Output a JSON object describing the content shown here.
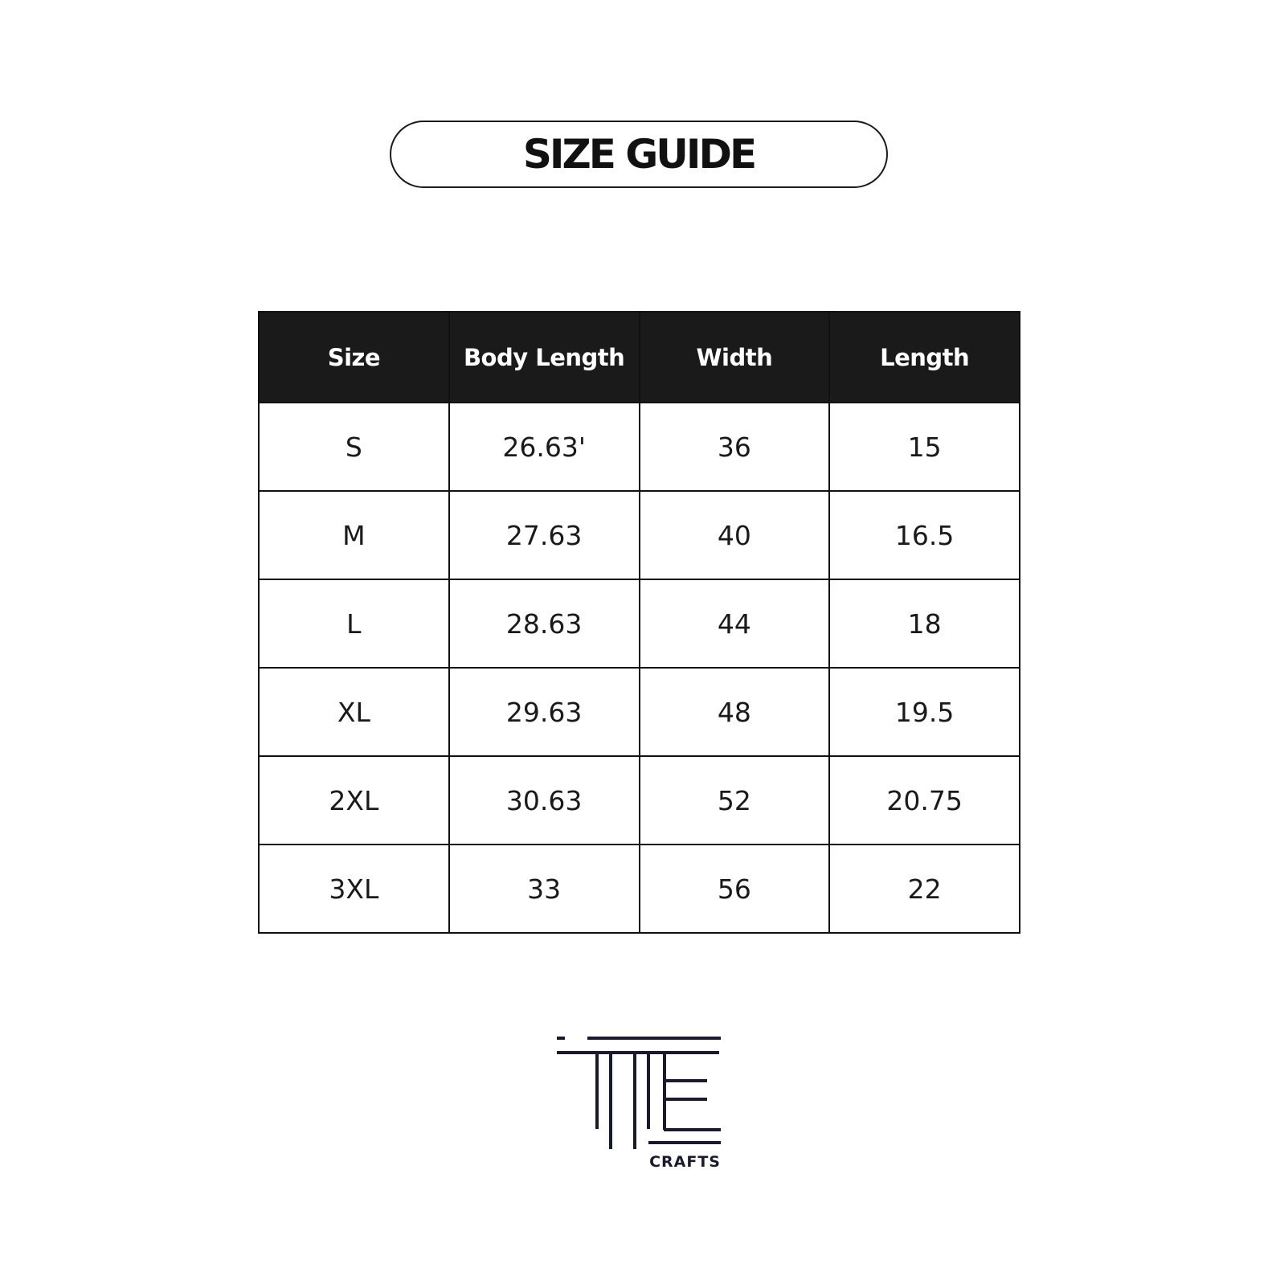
{
  "title": "SIZE GUIDE",
  "table": {
    "headers": [
      "Size",
      "Body Length",
      "Width",
      "Length"
    ],
    "rows": [
      [
        "S",
        "26.63'",
        "36",
        "15"
      ],
      [
        "M",
        "27.63",
        "40",
        "16.5"
      ],
      [
        "L",
        "28.63",
        "44",
        "18"
      ],
      [
        "XL",
        "29.63",
        "48",
        "19.5"
      ],
      [
        "2XL",
        "30.63",
        "52",
        "20.75"
      ],
      [
        "3XL",
        "33",
        "56",
        "22"
      ]
    ]
  },
  "brand": {
    "name": "CRAFTS",
    "color": "#1a1a2e"
  }
}
